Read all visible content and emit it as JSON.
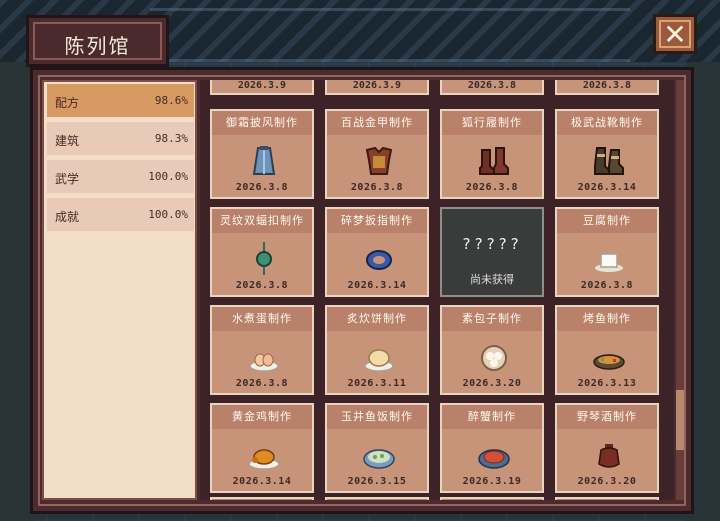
{
  "window": {
    "title": "陈列馆",
    "close_glyph": "✕"
  },
  "sidebar": {
    "items": [
      {
        "label": "配方",
        "percent": "98.6%",
        "active": true
      },
      {
        "label": "建筑",
        "percent": "98.3%",
        "active": false
      },
      {
        "label": "武学",
        "percent": "100.0%",
        "active": false
      },
      {
        "label": "成就",
        "percent": "100.0%",
        "active": false
      }
    ]
  },
  "grid": {
    "partial_top_dates": [
      "2026.3.9",
      "2026.3.9",
      "2026.3.8",
      "2026.3.8"
    ],
    "cards": [
      {
        "title": "御霜披风制作",
        "date": "2026.3.8",
        "icon": "cape-icon"
      },
      {
        "title": "百战金甲制作",
        "date": "2026.3.8",
        "icon": "armor-icon"
      },
      {
        "title": "狐行履制作",
        "date": "2026.3.8",
        "icon": "boots-icon"
      },
      {
        "title": "极武战靴制作",
        "date": "2026.3.14",
        "icon": "war-boots-icon"
      },
      {
        "title": "灵纹双蝠扣制作",
        "date": "2026.3.8",
        "icon": "jade-pendant-icon"
      },
      {
        "title": "碎梦扳指制作",
        "date": "2026.3.14",
        "icon": "ring-icon"
      },
      {
        "locked": true,
        "question": "?????",
        "text": "尚未获得"
      },
      {
        "title": "豆腐制作",
        "date": "2026.3.8",
        "icon": "tofu-icon"
      },
      {
        "title": "水煮蛋制作",
        "date": "2026.3.8",
        "icon": "boiled-egg-icon"
      },
      {
        "title": "炙炊饼制作",
        "date": "2026.3.11",
        "icon": "flatbread-icon"
      },
      {
        "title": "素包子制作",
        "date": "2026.3.20",
        "icon": "bun-icon"
      },
      {
        "title": "烤鱼制作",
        "date": "2026.3.13",
        "icon": "grilled-fish-icon"
      },
      {
        "title": "黄金鸡制作",
        "date": "2026.3.14",
        "icon": "golden-chicken-icon"
      },
      {
        "title": "玉井鱼饭制作",
        "date": "2026.3.15",
        "icon": "fish-rice-icon"
      },
      {
        "title": "醉蟹制作",
        "date": "2026.3.19",
        "icon": "drunken-crab-icon"
      },
      {
        "title": "野琴酒制作",
        "date": "2026.3.20",
        "icon": "wine-jar-icon"
      }
    ]
  },
  "colors": {
    "panel": "#4a2b2e",
    "card": "#c7947a",
    "card_header": "#b9806a",
    "sidebar_active": "#d89a63",
    "close_button": "#9b5a3e"
  }
}
